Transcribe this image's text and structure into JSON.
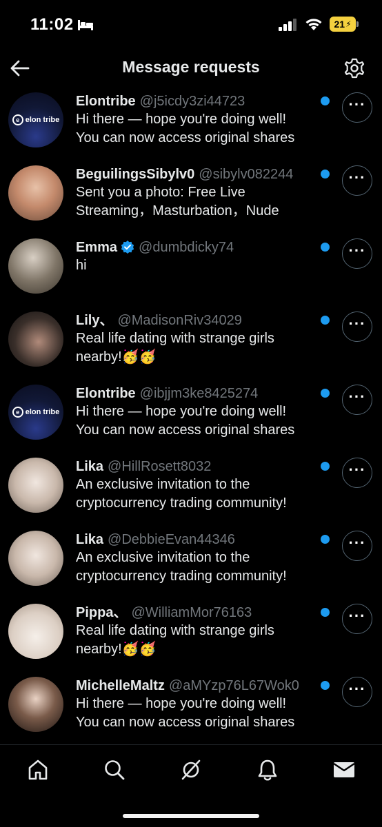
{
  "status_bar": {
    "time": "11:02",
    "battery": "21"
  },
  "header": {
    "title": "Message requests"
  },
  "requests": [
    {
      "name": "Elontribe",
      "handle": "@j5icdy3zi44723",
      "line1": "Hi there — hope you're doing well!",
      "line2": "You can now access original shares",
      "avatar_text": "elon tribe",
      "verified": false
    },
    {
      "name": "BeguilingsSibylv0",
      "handle": "@sibylv082244",
      "line1": "Sent you a photo: Free Live",
      "line2": "Streaming，Masturbation，Nude",
      "verified": false
    },
    {
      "name": "Emma",
      "handle": "@dumbdicky74",
      "line1": "hi",
      "line2": "",
      "verified": true
    },
    {
      "name": "Lily、",
      "handle": "@MadisonRiv34029",
      "line1": "Real life dating with strange girls",
      "line2": "nearby!🥳🥳",
      "verified": false
    },
    {
      "name": "Elontribe",
      "handle": "@ibjjm3ke8425274",
      "line1": "Hi there — hope you're doing well!",
      "line2": "You can now access original shares",
      "avatar_text": "elon tribe",
      "verified": false
    },
    {
      "name": "Lika",
      "handle": "@HillRosett8032",
      "line1": "An exclusive invitation to the",
      "line2": "cryptocurrency trading community!",
      "verified": false
    },
    {
      "name": "Lika",
      "handle": "@DebbieEvan44346",
      "line1": "An exclusive invitation to the",
      "line2": "cryptocurrency trading community!",
      "verified": false
    },
    {
      "name": "Pippa、",
      "handle": "@WilliamMor76163",
      "line1": "Real life dating with strange girls",
      "line2": "nearby!🥳🥳",
      "verified": false
    },
    {
      "name": "MichelleMaltz",
      "handle": "@aMYzp76L67Wok0",
      "line1": "Hi there — hope you're doing well!",
      "line2": "You can now access original shares",
      "verified": false
    }
  ],
  "more_label": "···",
  "icons": {
    "back": "arrow-left-icon",
    "settings": "gear-icon",
    "unread": "unread-dot-icon",
    "tabs": [
      "home-icon",
      "search-icon",
      "grok-icon",
      "bell-icon",
      "mail-icon"
    ]
  },
  "colors": {
    "accent": "#1d9bf0",
    "background": "#000000",
    "text": "#e7e9ea",
    "muted": "#71767b"
  }
}
